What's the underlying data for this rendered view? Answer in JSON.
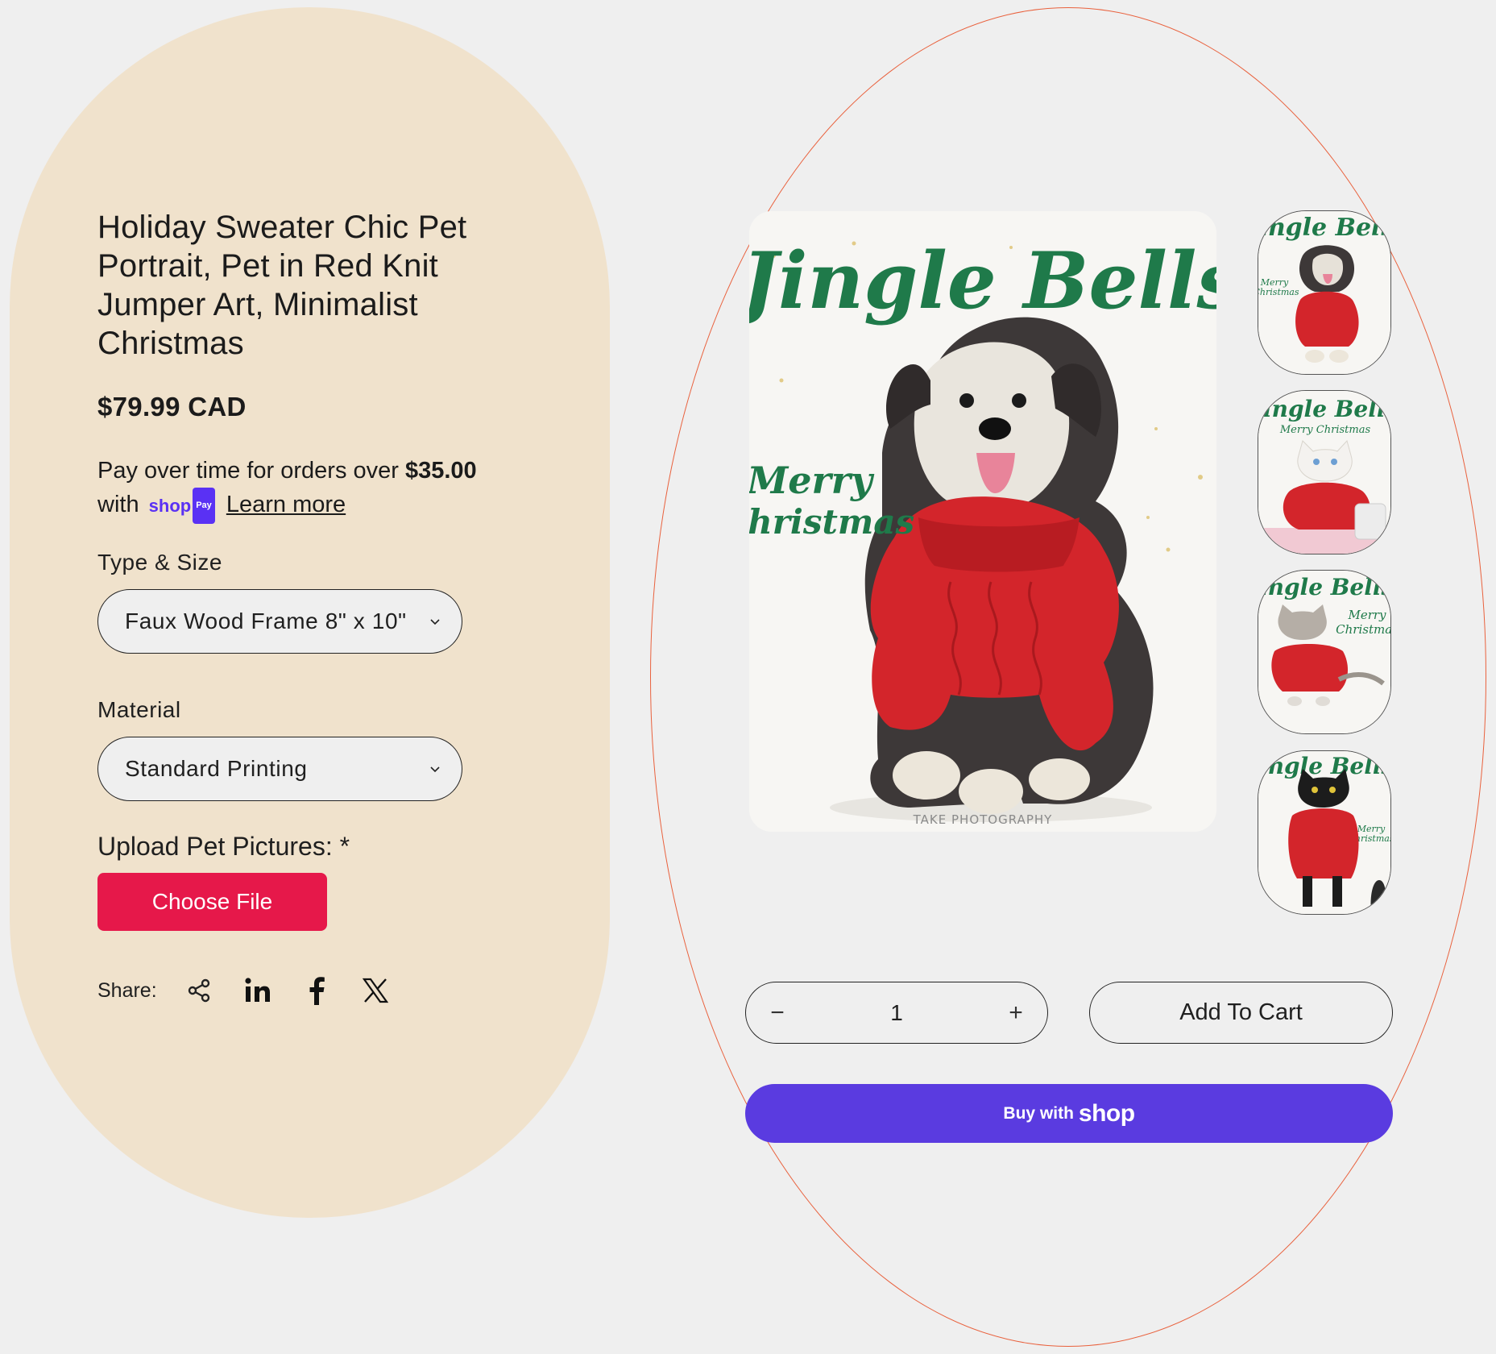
{
  "product": {
    "title": "Holiday Sweater Chic Pet Portrait, Pet in Red Knit Jumper Art, Minimalist Christmas",
    "price": "$79.99 CAD"
  },
  "installments": {
    "prefix": "Pay over time for orders over ",
    "threshold": "$35.00",
    "with_text": "with",
    "shop_word": "shop",
    "pay_badge": "Pay",
    "learn_more": "Learn more"
  },
  "options": {
    "type_size": {
      "label": "Type & Size",
      "value": "Faux Wood Frame 8\" x 10\""
    },
    "material": {
      "label": "Material",
      "value": "Standard Printing"
    }
  },
  "upload": {
    "label": "Upload Pet Pictures: *",
    "button": "Choose File"
  },
  "share": {
    "label": "Share:",
    "icons": [
      "share-icon",
      "linkedin-icon",
      "facebook-icon",
      "x-twitter-icon"
    ]
  },
  "gallery": {
    "main": {
      "headline": "Jingle Bells",
      "side_text_1": "Merry",
      "side_text_2": "Christmas",
      "watermark": "TAKE PHOTOGRAPHY"
    },
    "thumbnails": [
      {
        "headline": "Jingle Bells",
        "sub1": "Merry",
        "sub2": "Christmas",
        "pet": "dog"
      },
      {
        "headline": "Jingle Bells",
        "sub1": "Merry Christmas",
        "sub2": "",
        "pet": "white-cat"
      },
      {
        "headline": "Jingle Bells",
        "sub1": "Merry",
        "sub2": "Christmas",
        "pet": "grey-cat"
      },
      {
        "headline": "Jingle Bells",
        "sub1": "Merry",
        "sub2": "Christmas",
        "pet": "black-cat"
      }
    ]
  },
  "cart": {
    "quantity": "1",
    "decrease": "−",
    "increase": "+",
    "add_to_cart": "Add To Cart",
    "buy_with": "Buy with",
    "buy_brand": "shop"
  },
  "colors": {
    "left_panel": "#f0e2cc",
    "accent_red": "#e6184a",
    "shop_purple": "#5a3be0",
    "oval_border": "#e9613d",
    "christmas_green": "#1f7a4a",
    "sweater_red": "#d3252b"
  }
}
